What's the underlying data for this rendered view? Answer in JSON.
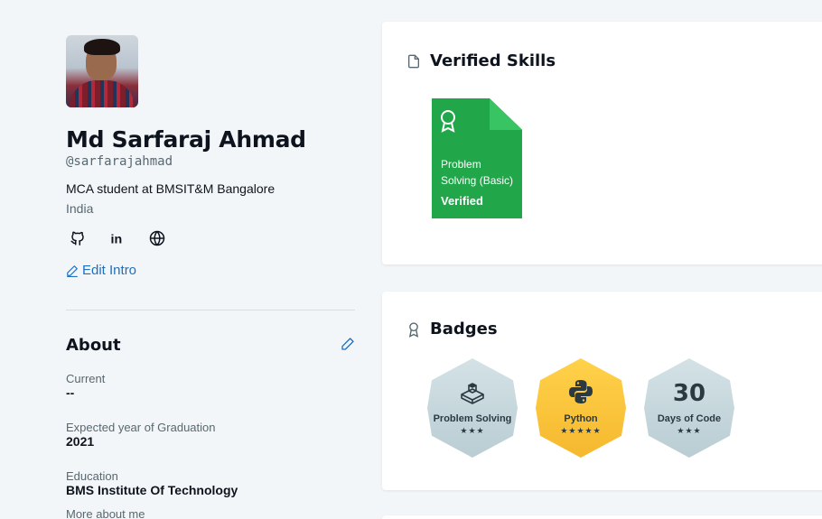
{
  "profile": {
    "name": "Md Sarfaraj Ahmad",
    "handle": "@sarfarajahmad",
    "bio": "MCA student at BMSIT&M Bangalore",
    "location": "India",
    "socials": [
      {
        "name": "github-icon",
        "glyph": "github"
      },
      {
        "name": "linkedin-icon",
        "glyph": "in"
      },
      {
        "name": "globe-icon",
        "glyph": "globe"
      }
    ],
    "edit_intro_label": "Edit Intro"
  },
  "about": {
    "title": "About",
    "fields": [
      {
        "label": "Current",
        "value": "--"
      },
      {
        "label": "Expected year of Graduation",
        "value": "2021"
      },
      {
        "label": "Education",
        "value": "BMS Institute Of Technology"
      },
      {
        "label": "More about me",
        "value": ""
      }
    ]
  },
  "verified_skills": {
    "title": "Verified Skills",
    "items": [
      {
        "name": "Problem Solving (Basic)",
        "status": "Verified",
        "color": "#21a74a"
      }
    ]
  },
  "badges": {
    "title": "Badges",
    "items": [
      {
        "label": "Problem Solving",
        "stars": "★★★",
        "icon": "cube-icon",
        "color": "#c7d8dd"
      },
      {
        "label": "Python",
        "stars": "★★★★★",
        "icon": "python-icon",
        "color": "#f8c53a"
      },
      {
        "label": "Days of Code",
        "stars": "★★★",
        "number": "30",
        "color": "#c7d8dd"
      }
    ]
  },
  "colors": {
    "link": "#1f6fbf",
    "text": "#0e141e",
    "muted": "#576871",
    "background": "#f3f6f8"
  }
}
